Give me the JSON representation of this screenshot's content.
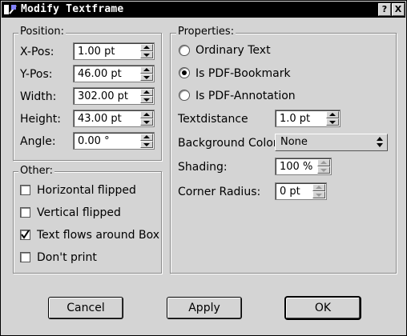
{
  "window": {
    "title": "Modify Textframe"
  },
  "titlebar_buttons": {
    "help": "?",
    "close": "X"
  },
  "position": {
    "title": "Position:",
    "fields": [
      {
        "label": "X-Pos:",
        "value": "1.00 pt"
      },
      {
        "label": "Y-Pos:",
        "value": "46.00 pt"
      },
      {
        "label": "Width:",
        "value": "302.00 pt"
      },
      {
        "label": "Height:",
        "value": "43.00 pt"
      },
      {
        "label": "Angle:",
        "value": "0.00 °"
      }
    ]
  },
  "other": {
    "title": "Other:",
    "options": [
      {
        "label": "Horizontal flipped",
        "checked": false
      },
      {
        "label": "Vertical flipped",
        "checked": false
      },
      {
        "label": "Text flows around Box",
        "checked": true
      },
      {
        "label": "Don't print",
        "checked": false
      }
    ]
  },
  "properties": {
    "title": "Properties:",
    "radios": [
      {
        "label": "Ordinary Text",
        "selected": false
      },
      {
        "label": "Is PDF-Bookmark",
        "selected": true
      },
      {
        "label": "Is PDF-Annotation",
        "selected": false
      }
    ],
    "textdistance": {
      "label": "Textdistance",
      "value": "1.0 pt"
    },
    "background_color": {
      "label": "Background Color:",
      "value": "None"
    },
    "shading": {
      "label": "Shading:",
      "value": "100 %"
    },
    "corner_radius": {
      "label": "Corner Radius:",
      "value": "0 pt"
    }
  },
  "buttons": {
    "cancel": "Cancel",
    "apply": "Apply",
    "ok": "OK"
  }
}
